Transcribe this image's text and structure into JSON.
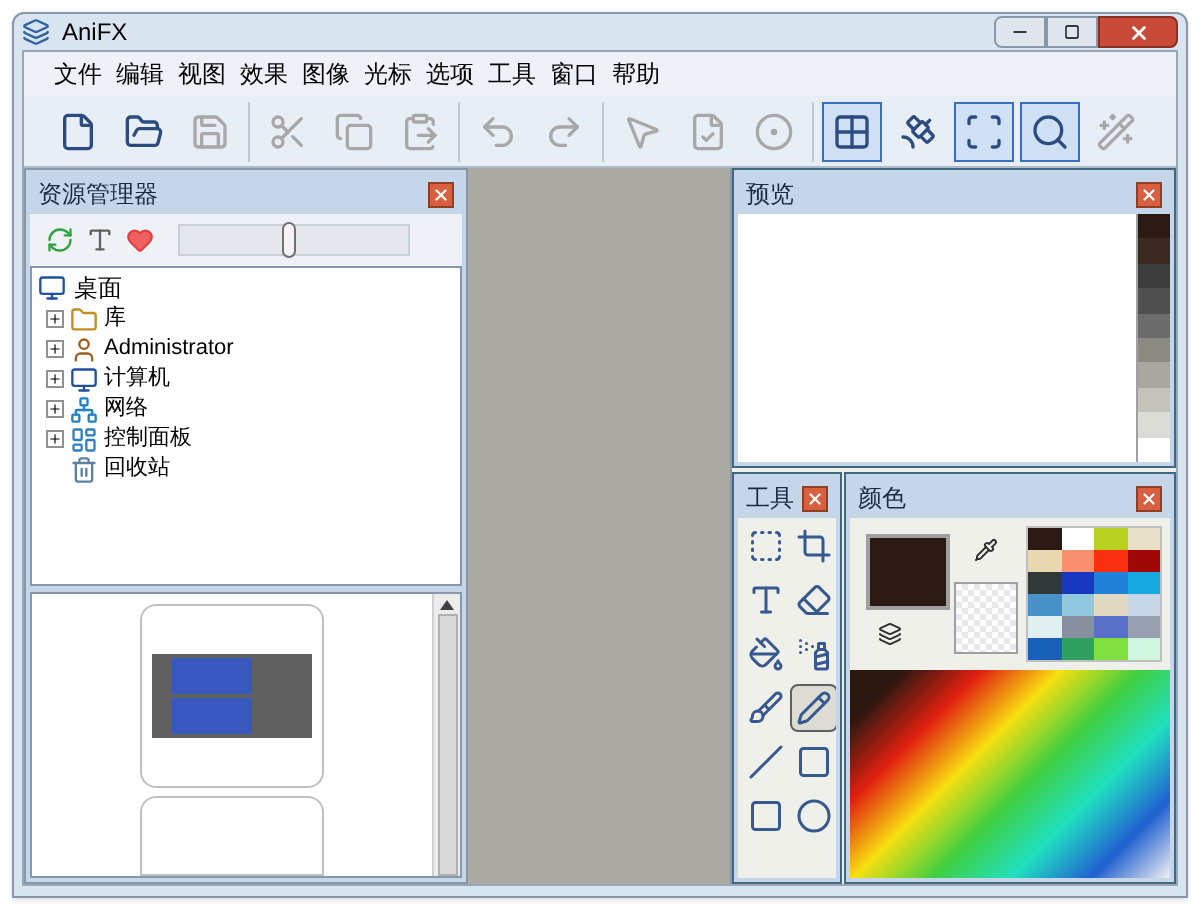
{
  "window": {
    "title": "AniFX"
  },
  "menu": [
    "文件",
    "编辑",
    "视图",
    "效果",
    "图像",
    "光标",
    "选项",
    "工具",
    "窗口",
    "帮助"
  ],
  "toolbar": [
    [
      {
        "kind": "new",
        "disabled": false,
        "selected": false
      },
      {
        "kind": "open",
        "disabled": false,
        "selected": false
      },
      {
        "kind": "save",
        "disabled": true,
        "selected": false
      }
    ],
    [
      {
        "kind": "cut",
        "disabled": true,
        "selected": false
      },
      {
        "kind": "copy",
        "disabled": true,
        "selected": false
      },
      {
        "kind": "paste",
        "disabled": true,
        "selected": false
      }
    ],
    [
      {
        "kind": "undo",
        "disabled": true,
        "selected": false
      },
      {
        "kind": "redo",
        "disabled": true,
        "selected": false
      }
    ],
    [
      {
        "kind": "pointer",
        "disabled": true,
        "selected": false
      },
      {
        "kind": "check",
        "disabled": true,
        "selected": false
      },
      {
        "kind": "ball",
        "disabled": true,
        "selected": false
      }
    ],
    [
      {
        "kind": "grid",
        "disabled": false,
        "selected": true
      },
      {
        "kind": "satellite",
        "disabled": false,
        "selected": false
      },
      {
        "kind": "frame",
        "disabled": false,
        "selected": true
      },
      {
        "kind": "zoom",
        "disabled": false,
        "selected": true
      },
      {
        "kind": "wand",
        "disabled": true,
        "selected": false
      }
    ]
  ],
  "explorer": {
    "title": "资源管理器",
    "slider": {
      "level": 0.47
    },
    "tree": [
      {
        "label": "桌面",
        "kind": "desktop",
        "children": [
          {
            "label": "库",
            "kind": "folder",
            "expanded": false
          },
          {
            "label": "Administrator",
            "kind": "user",
            "expanded": false
          },
          {
            "label": "计算机",
            "kind": "computer",
            "expanded": false
          },
          {
            "label": "网络",
            "kind": "network",
            "expanded": false
          },
          {
            "label": "控制面板",
            "kind": "panel",
            "expanded": false
          },
          {
            "label": "回收站",
            "kind": "trash"
          }
        ]
      }
    ]
  },
  "preview": {
    "title": "预览",
    "shades": [
      {
        "color": "#2b1a14"
      },
      {
        "color": "#3a2a22"
      },
      {
        "color": "#3c3c3c"
      },
      {
        "color": "#505050"
      },
      {
        "color": "#6c6c6c"
      },
      {
        "color": "#8a8a80"
      },
      {
        "color": "#a8a8a0"
      },
      {
        "color": "#c4c4bc"
      },
      {
        "color": "#dcdcd6"
      },
      {
        "color": "#ffffff"
      }
    ]
  },
  "tools": {
    "title": "工具",
    "items": [
      {
        "kind": "select",
        "selected": false
      },
      {
        "kind": "crop",
        "selected": false
      },
      {
        "kind": "text",
        "selected": false
      },
      {
        "kind": "eraser",
        "selected": false
      },
      {
        "kind": "fill",
        "selected": false
      },
      {
        "kind": "spray",
        "selected": false
      },
      {
        "kind": "brush",
        "selected": false
      },
      {
        "kind": "pencil",
        "selected": true
      },
      {
        "kind": "line",
        "selected": false
      },
      {
        "kind": "rect",
        "selected": false
      },
      {
        "kind": "roundrect",
        "selected": false
      },
      {
        "kind": "ellipse",
        "selected": false
      }
    ]
  },
  "colors": {
    "title": "颜色",
    "primary": {
      "color": "#2b1a14"
    },
    "palette": [
      {
        "color": "#2b1a14"
      },
      {
        "color": "#ffffff"
      },
      {
        "color": "#b8d020"
      },
      {
        "color": "#e8e0c8"
      },
      {
        "color": "#e8d8b0"
      },
      {
        "color": "#f89070"
      },
      {
        "color": "#f83010"
      },
      {
        "color": "#a00808"
      },
      {
        "color": "#303838"
      },
      {
        "color": "#1838c0"
      },
      {
        "color": "#2080d8"
      },
      {
        "color": "#18a8e0"
      },
      {
        "color": "#4890c8"
      },
      {
        "color": "#90c8e0"
      },
      {
        "color": "#e0d8c0"
      },
      {
        "color": "#c8d8e8"
      },
      {
        "color": "#e0f0f0"
      },
      {
        "color": "#8890a0"
      },
      {
        "color": "#5870c8"
      },
      {
        "color": "#98a0b0"
      },
      {
        "color": "#1860b8"
      },
      {
        "color": "#30a060"
      },
      {
        "color": "#80e040"
      },
      {
        "color": "#d0f8e0"
      }
    ]
  }
}
